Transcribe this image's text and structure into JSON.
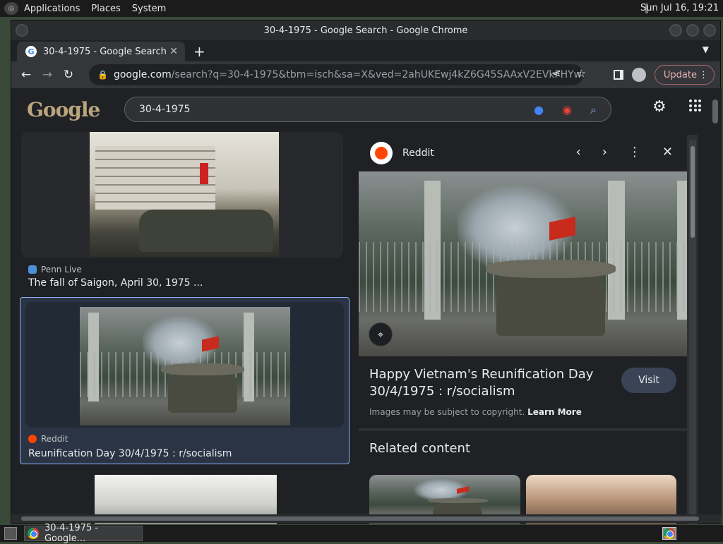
{
  "top_panel": {
    "menus": [
      "Applications",
      "Places",
      "System"
    ],
    "clock": "Sun Jul 16, 19:21"
  },
  "window": {
    "title": "30-4-1975 - Google Search - Google Chrome"
  },
  "tab": {
    "title": "30-4-1975 - Google Search",
    "close": "✕",
    "new_tab": "+"
  },
  "toolbar": {
    "url_host": "google.com",
    "url_path": "/search?q=30-4-1975&tbm=isch&sa=X&ved=2ahUKEwj4kZ6G45SAAxV2EVkFHYwDBVI...",
    "update_label": "Update"
  },
  "search": {
    "query": "30-4-1975",
    "logo_text": "Google"
  },
  "results": [
    {
      "source": "Penn Live",
      "title": "The fall of Saigon, April 30, 1975 ..."
    },
    {
      "source": "Reddit",
      "title": "Reunification Day 30/4/1975 : r/socialism"
    }
  ],
  "preview": {
    "source": "Reddit",
    "title": "Happy Vietnam's Reunification Day 30/4/1975 : r/socialism",
    "visit_label": "Visit",
    "copyright": "Images may be subject to copyright.",
    "learn_more": "Learn More",
    "related_heading": "Related content"
  },
  "taskbar": {
    "task_label": "30-4-1975 - Google..."
  },
  "colors": {
    "accent": "#8ab4f8",
    "selected_bg": "#2b3444",
    "reddit": "#ff4500"
  }
}
